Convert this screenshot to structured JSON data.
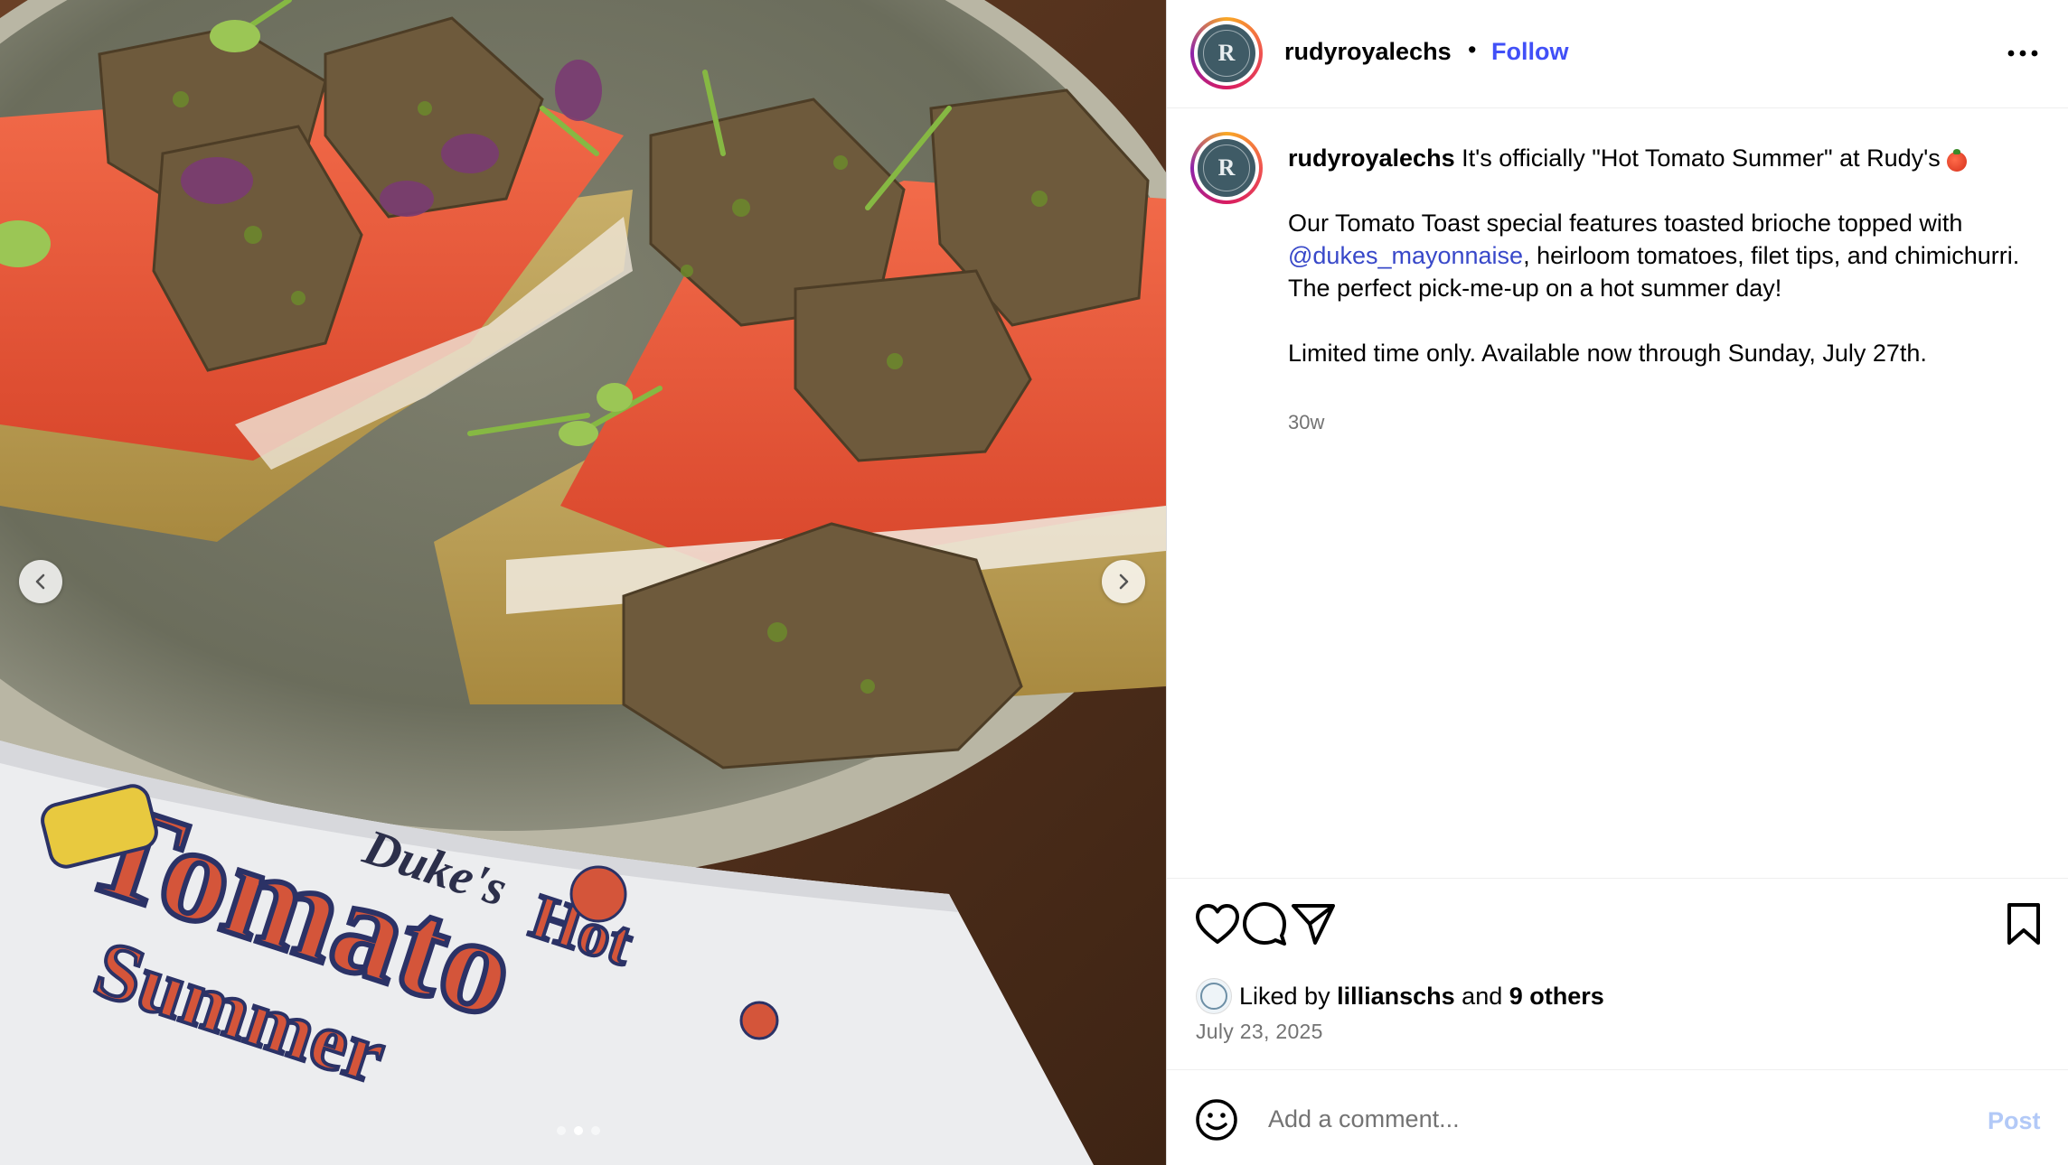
{
  "post": {
    "username": "rudyroyalechs",
    "separator": "•",
    "follow_label": "Follow",
    "avatar_initial": "R",
    "more_icon": "more-horizontal-icon"
  },
  "caption": {
    "username": "rudyroyalechs",
    "intro": "It's officially \"Hot Tomato Summer\" at Rudy's",
    "intro_emoji": "tomato-emoji",
    "para1_before": "Our Tomato Toast special features toasted brioche topped with ",
    "para1_mention": "@dukes_mayonnaise",
    "para1_after": ", heirloom tomatoes, filet tips, and chimichurri. The perfect pick-me-up on a hot summer day!",
    "para2": "Limited time only. Available now through Sunday, July 27th.",
    "timestamp": "30w"
  },
  "actions": {
    "icons": [
      "heart-icon",
      "comment-icon",
      "share-icon",
      "bookmark-icon"
    ],
    "liked_by_prefix": "Liked by",
    "liked_by_user": "lillianschs",
    "liked_by_and": "and",
    "liked_by_others": "9 others",
    "date": "July 23, 2025"
  },
  "comment": {
    "placeholder": "Add a comment...",
    "post_label": "Post"
  },
  "carousel": {
    "total_slides": 3,
    "active_slide": 2
  },
  "colors": {
    "follow_blue": "#4150f7",
    "mention_blue": "#3848c9",
    "post_disabled": "#b2c9f7",
    "secondary_text": "#737373"
  }
}
